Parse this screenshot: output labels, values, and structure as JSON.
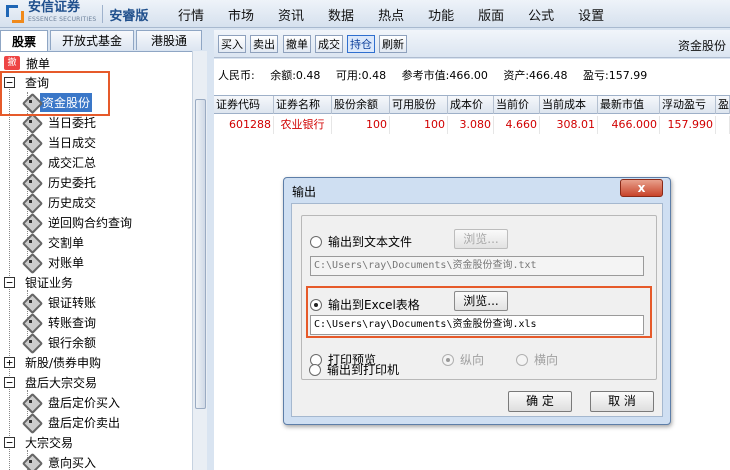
{
  "app": {
    "logo_name": "安信证券",
    "logo_sub": "ESSENCE SECURITIES",
    "version": "安睿版",
    "menu": [
      "行情",
      "市场",
      "资讯",
      "数据",
      "热点",
      "功能",
      "版面",
      "公式",
      "设置"
    ]
  },
  "left_tabs": [
    {
      "label": "股票",
      "active": true
    },
    {
      "label": "开放式基金",
      "active": false
    },
    {
      "label": "港股通",
      "active": false
    }
  ],
  "tree": {
    "revoke": "撤单",
    "query": "查询",
    "query_items": [
      "资金股份",
      "当日委托",
      "当日成交",
      "成交汇总",
      "历史委托",
      "历史成交",
      "逆回购合约查询",
      "交割单",
      "对账单"
    ],
    "bank": "银证业务",
    "bank_items": [
      "银证转账",
      "转账查询",
      "银行余额"
    ],
    "ipo": "新股/债券申购",
    "after_hours": "盘后大宗交易",
    "after_hours_items": [
      "盘后定价买入",
      "盘后定价卖出"
    ],
    "block": "大宗交易",
    "block_items": [
      "意向买入"
    ]
  },
  "toolbar": {
    "buttons": [
      {
        "label": "买入",
        "active": false
      },
      {
        "label": "卖出",
        "active": false
      },
      {
        "label": "撤单",
        "active": false
      },
      {
        "label": "成交",
        "active": false
      },
      {
        "label": "持仓",
        "active": true
      },
      {
        "label": "刷新",
        "active": false
      }
    ],
    "title": "资金股份"
  },
  "summary": {
    "currency": "人民币:",
    "balance": "余额:0.48",
    "available": "可用:0.48",
    "ref_value": "参考市值:466.00",
    "assets": "资产:466.48",
    "pnl": "盈亏:157.99"
  },
  "grid": {
    "headers": [
      "证券代码",
      "证券名称",
      "股份余额",
      "可用股份",
      "成本价",
      "当前价",
      "当前成本",
      "最新市值",
      "浮动盈亏",
      "盈"
    ],
    "rows": [
      [
        "601288",
        "农业银行",
        "100",
        "100",
        "3.080",
        "4.660",
        "308.01",
        "466.000",
        "157.990",
        ""
      ]
    ]
  },
  "dialog": {
    "title": "输出",
    "close": "x",
    "opt_text_file": "输出到文本文件",
    "text_path": "C:\\Users\\ray\\Documents\\资金股份查询.txt",
    "opt_excel": "输出到Excel表格",
    "excel_path": "C:\\Users\\ray\\Documents\\资金股份查询.xls",
    "browse": "浏览...",
    "opt_print_preview": "打印预览",
    "portrait": "纵向",
    "landscape": "横向",
    "opt_printer": "输出到打印机",
    "ok": "确  定",
    "cancel": "取  消"
  },
  "colors": {
    "highlight": "#e65a2a",
    "selected": "#3a77c8",
    "data_red": "#d10000"
  }
}
